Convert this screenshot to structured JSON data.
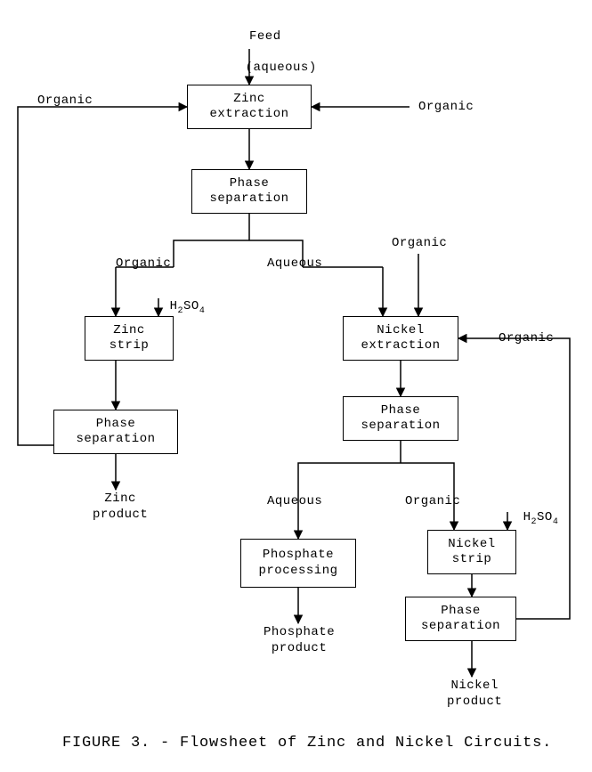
{
  "feed": {
    "line1": "Feed",
    "line2": "(aqueous)"
  },
  "boxes": {
    "zinc_extraction": "Zinc\nextraction",
    "phase_sep_1": "Phase\nseparation",
    "zinc_strip": "Zinc\nstrip",
    "phase_sep_zinc": "Phase\nseparation",
    "nickel_extraction": "Nickel\nextraction",
    "phase_sep_nickel1": "Phase\nseparation",
    "phosphate_proc": "Phosphate\nprocessing",
    "nickel_strip": "Nickel\nstrip",
    "phase_sep_nickel2": "Phase\nseparation"
  },
  "labels": {
    "organic_left": "Organic",
    "organic_right": "Organic",
    "organic_branch_left": "Organic",
    "aqueous_branch_right": "Aqueous",
    "organic_vert_right": "Organic",
    "h2so4_left": "H",
    "h2so4_left_sub2": "2",
    "h2so4_left_so": "SO",
    "h2so4_left_sub4": "4",
    "zinc_product": "Zinc\nproduct",
    "organic_far_right": "Organic",
    "aqueous_lower": "Aqueous",
    "organic_lower_right": "Organic",
    "h2so4_right": "H",
    "h2so4_right_sub2": "2",
    "h2so4_right_so": "SO",
    "h2so4_right_sub4": "4",
    "phosphate_product": "Phosphate\nproduct",
    "nickel_product": "Nickel\nproduct"
  },
  "caption": "FIGURE 3. - Flowsheet of Zinc and Nickel Circuits."
}
